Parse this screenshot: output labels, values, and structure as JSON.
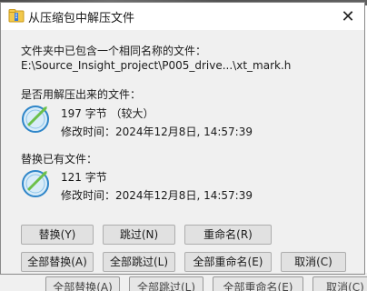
{
  "dialog": {
    "title": "从压缩包中解压文件",
    "close_glyph": "✕",
    "intro_label": "文件夹中已包含一个相同名称的文件：",
    "path": "E:\\Source_Insight_project\\P005_drive...\\xt_mark.h",
    "overwrite_label": "是否用解压出来的文件：",
    "new_file": {
      "size": "197 字节 （较大）",
      "modified": "修改时间：2024年12月8日, 14:57:39"
    },
    "replace_label": "替换已有文件：",
    "existing_file": {
      "size": "121 字节",
      "modified": "修改时间：2024年12月8日, 14:57:39"
    },
    "buttons": {
      "replace": "替换(Y)",
      "skip": "跳过(N)",
      "rename": "重命名(R)",
      "replace_all": "全部替换(A)",
      "skip_all": "全部跳过(L)",
      "rename_all": "全部重命名(E)",
      "cancel": "取消(C)"
    }
  },
  "background": {
    "ghost_buttons": [
      "全部替换(A)",
      "全部跳过(L)",
      "全部重命名(E)",
      "取消(C)"
    ]
  },
  "colors": {
    "dialog_bg": "#f0f0f0",
    "button_bg": "#e1e1e1",
    "button_border": "#adadad",
    "icon_blue": "#2f86c9",
    "icon_green": "#6cc04a"
  }
}
